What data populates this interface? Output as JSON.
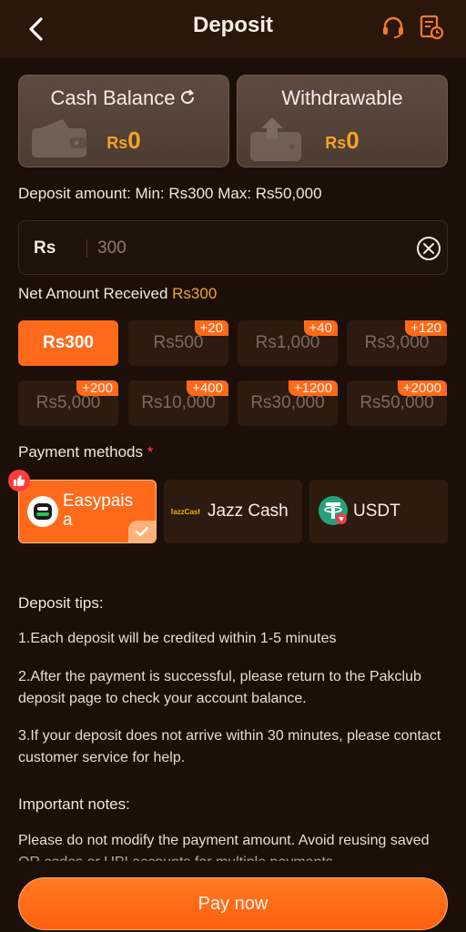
{
  "header": {
    "title": "Deposit",
    "back_icon": "chevron-left-icon",
    "support_icon": "headset-icon",
    "history_icon": "deposit-history-icon"
  },
  "balances": {
    "cash": {
      "title": "Cash Balance",
      "currency": "Rs",
      "amount": "0"
    },
    "withdrawable": {
      "title": "Withdrawable",
      "currency": "Rs",
      "amount": "0"
    }
  },
  "deposit": {
    "limits_text": "Deposit amount: Min: Rs300 Max: Rs50,000",
    "currency": "Rs",
    "input_placeholder": "300",
    "net_label": "Net Amount Received",
    "net_value": "Rs300"
  },
  "amount_chips": [
    {
      "label": "Rs300",
      "bonus": ""
    },
    {
      "label": "Rs500",
      "bonus": "+20"
    },
    {
      "label": "Rs1,000",
      "bonus": "+40"
    },
    {
      "label": "Rs3,000",
      "bonus": "+120"
    },
    {
      "label": "Rs5,000",
      "bonus": "+200"
    },
    {
      "label": "Rs10,000",
      "bonus": "+400"
    },
    {
      "label": "Rs30,000",
      "bonus": "+1200"
    },
    {
      "label": "Rs50,000",
      "bonus": "+2000"
    }
  ],
  "payment": {
    "title": "Payment methods",
    "required_mark": "*",
    "methods": [
      {
        "line1": "Easypais",
        "line2": "a",
        "icon": "easypaisa-logo-icon"
      },
      {
        "label": "Jazz Cash",
        "icon": "jazzcash-logo-icon",
        "logo_text": "JazzCash"
      },
      {
        "label": "USDT",
        "icon": "tether-usdt-icon"
      }
    ]
  },
  "tips": {
    "title": "Deposit tips:",
    "items": [
      "1.Each deposit will be credited within 1-5 minutes",
      "2.After the payment is successful, please return to the Pakclub deposit page to check your account balance.",
      "3.If your deposit does not arrive within 30 minutes, please contact customer service for help."
    ]
  },
  "notes": {
    "title": "Important notes:",
    "text": "Please do not modify the payment amount. Avoid reusing saved QR codes or UPI accounts for multiple payments."
  },
  "pay_button": "Pay now",
  "colors": {
    "accent": "#ff6a1a",
    "amount": "#f5a321",
    "background": "#1c0f07"
  }
}
